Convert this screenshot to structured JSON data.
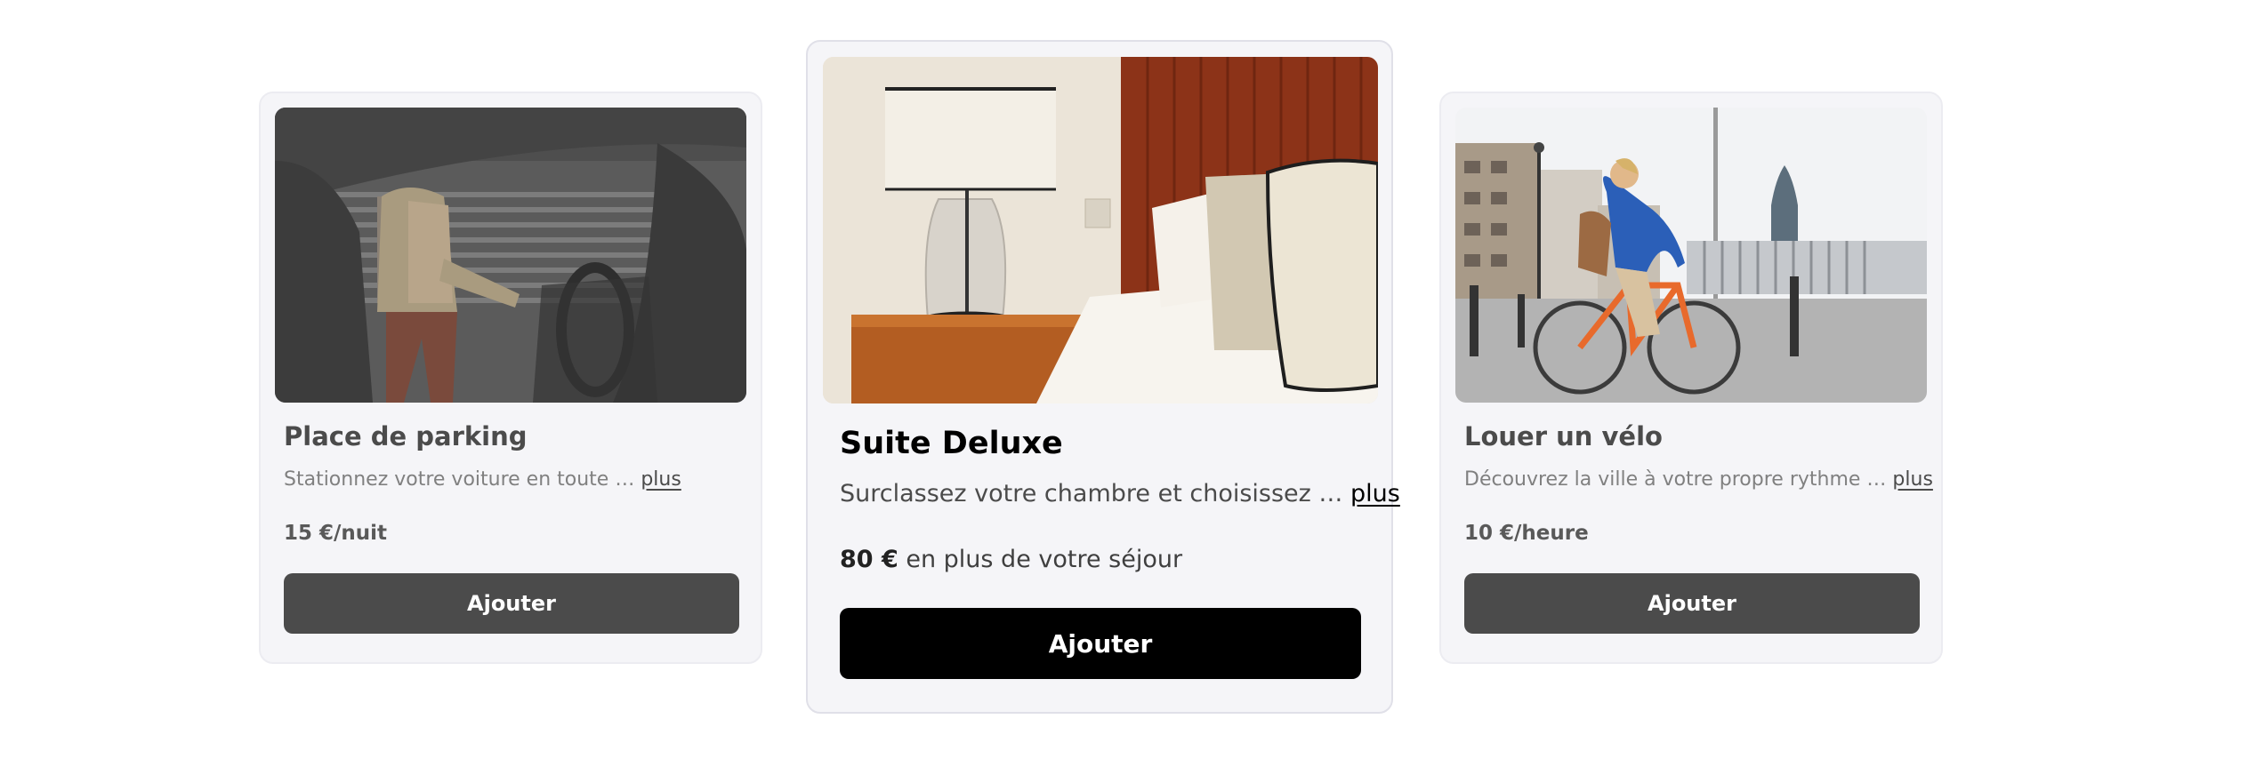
{
  "offers": {
    "parking": {
      "title": "Place de parking",
      "description": "Stationnez votre voiture en toute …",
      "more_label": "plus",
      "price": "15 €/nuit",
      "button_label": "Ajouter"
    },
    "suite": {
      "title": "Suite Deluxe",
      "description": "Surclassez votre chambre et choisissez …",
      "more_label": "plus",
      "price_amount": "80 €",
      "price_suffix": " en plus de votre séjour",
      "button_label": "Ajouter"
    },
    "bike": {
      "title": "Louer un vélo",
      "description": "Découvrez la ville à votre propre rythme …",
      "more_label": "plus",
      "price": "10 €/heure",
      "button_label": "Ajouter"
    }
  },
  "colors": {
    "card_bg": "#f5f5f8",
    "primary_button": "#000000",
    "secondary_button": "#4b4b4b"
  }
}
